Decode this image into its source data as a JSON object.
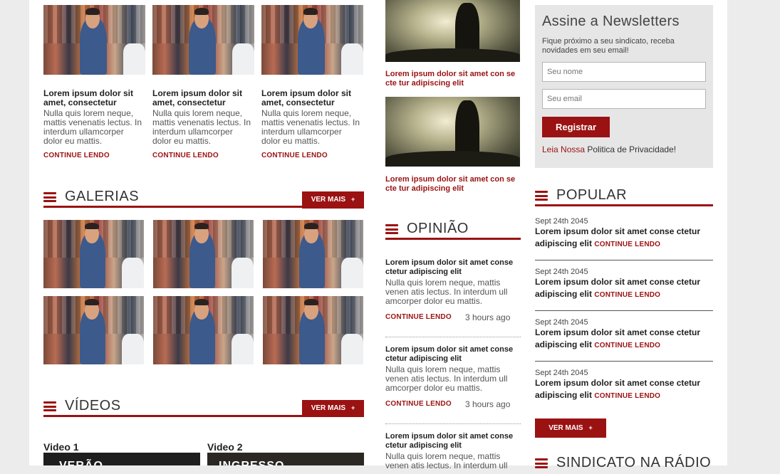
{
  "top_articles": [
    {
      "title": "Lorem ipsum dolor sit amet, consectetur",
      "excerpt": "Nulla quis lorem neque, mattis venenatis lectus. In interdum ullamcorper dolor eu mattis.",
      "more": "CONTINUE LENDO"
    },
    {
      "title": "Lorem ipsum dolor sit amet, consectetur",
      "excerpt": "Nulla quis lorem neque, mattis venenatis lectus. In interdum ullamcorper dolor eu mattis.",
      "more": "CONTINUE LENDO"
    },
    {
      "title": "Lorem ipsum dolor sit amet, consectetur",
      "excerpt": "Nulla quis lorem neque, mattis venenatis lectus. In interdum ullamcorper dolor eu mattis.",
      "more": "CONTINUE LENDO"
    }
  ],
  "galerias": {
    "heading": "GALERIAS",
    "ver_mais": "VER MAIS",
    "plus": "+"
  },
  "videos": {
    "heading": "VÍDEOS",
    "ver_mais": "VER MAIS",
    "plus": "+",
    "items": [
      {
        "label": "Video 1",
        "overlay": "VERÃO"
      },
      {
        "label": "Video 2",
        "overlay": "INGRESSO"
      }
    ]
  },
  "middle_images": [
    {
      "caption": "Lorem ipsum dolor sit amet con se cte tur adipiscing elit"
    },
    {
      "caption": "Lorem ipsum dolor sit amet con se cte tur adipiscing elit"
    }
  ],
  "opiniao": {
    "heading": "OPINIÃO",
    "items": [
      {
        "title": "Lorem ipsum dolor sit amet conse ctetur adipiscing elit",
        "excerpt": "Nulla quis lorem neque, mattis venen atis lectus. In interdum ull amcorper dolor eu mattis.",
        "more": "CONTINUE LENDO",
        "time": "3 hours ago"
      },
      {
        "title": "Lorem ipsum dolor sit amet conse ctetur adipiscing elit",
        "excerpt": "Nulla quis lorem neque, mattis venen atis lectus. In interdum ull amcorper dolor eu mattis.",
        "more": "CONTINUE LENDO",
        "time": "3 hours ago"
      },
      {
        "title": "Lorem ipsum dolor sit amet conse ctetur adipiscing elit",
        "excerpt": "Nulla quis lorem neque, mattis venen atis lectus. In interdum ull",
        "more": "",
        "time": ""
      }
    ]
  },
  "newsletter": {
    "title": "Assine a Newsletters",
    "description": "Fique próximo a seu sindicato, receba novidades em seu email!",
    "name_placeholder": "Seu nome",
    "email_placeholder": "Seu email",
    "submit": "Registrar",
    "privacy_link": "Leia Nossa",
    "privacy_text": " Politica de Privacidade!"
  },
  "popular": {
    "heading": "POPULAR",
    "items": [
      {
        "date": "Sept 24th 2045",
        "title": "Lorem ipsum dolor sit amet conse ctetur adipiscing elit",
        "more": "CONTINUE LENDO"
      },
      {
        "date": "Sept 24th 2045",
        "title": "Lorem ipsum dolor sit amet conse ctetur adipiscing elit",
        "more": "CONTINUE LENDO"
      },
      {
        "date": "Sept 24th 2045",
        "title": "Lorem ipsum dolor sit amet conse ctetur adipiscing elit",
        "more": "CONTINUE LENDO"
      },
      {
        "date": "Sept 24th 2045",
        "title": "Lorem ipsum dolor sit amet conse ctetur adipiscing elit",
        "more": "CONTINUE LENDO"
      }
    ],
    "ver_mais": "VER MAIS",
    "plus": "+"
  },
  "radio": {
    "heading": "SINDICATO NA RÁDIO"
  },
  "colors": {
    "accent": "#9b1212",
    "panel": "#e6e6e6",
    "background": "#ececec"
  }
}
